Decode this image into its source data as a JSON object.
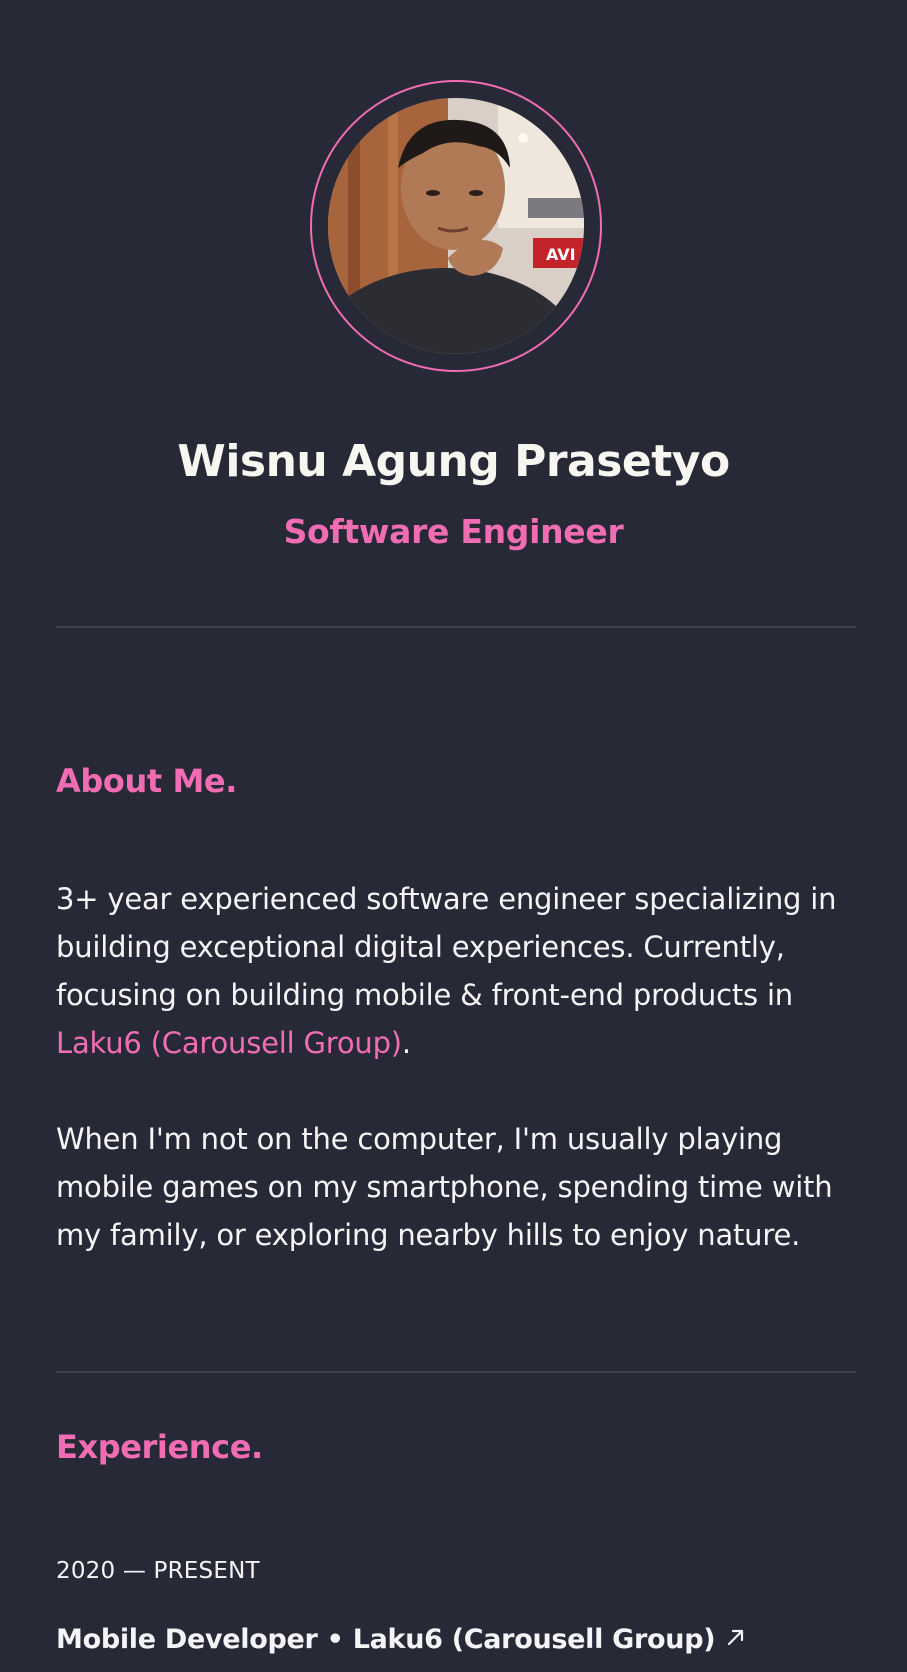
{
  "profile": {
    "name": "Wisnu Agung Prasetyo",
    "role": "Software Engineer",
    "avatar_icon": "profile-photo"
  },
  "about": {
    "title": "About Me.",
    "p1_text": "3+ year experienced software engineer specializing in building exceptional digital experiences. Currently, focusing on building mobile & front-end products in ",
    "p1_link": "Laku6 (Carousell Group)",
    "p1_end": ".",
    "p2_text": "When I'm not on the computer, I'm usually playing mobile games on my smartphone, spending time with my family, or exploring nearby hills to enjoy nature."
  },
  "experience": {
    "title": "Experience.",
    "items": [
      {
        "date": "2020 — PRESENT",
        "title": "Mobile Developer • Laku6 (Carousell Group)",
        "link_icon": "arrow-up-right-icon"
      }
    ]
  },
  "colors": {
    "background": "#282936",
    "accent": "#f06db3",
    "text": "#f5f5f7",
    "divider": "#3e3f4c"
  }
}
